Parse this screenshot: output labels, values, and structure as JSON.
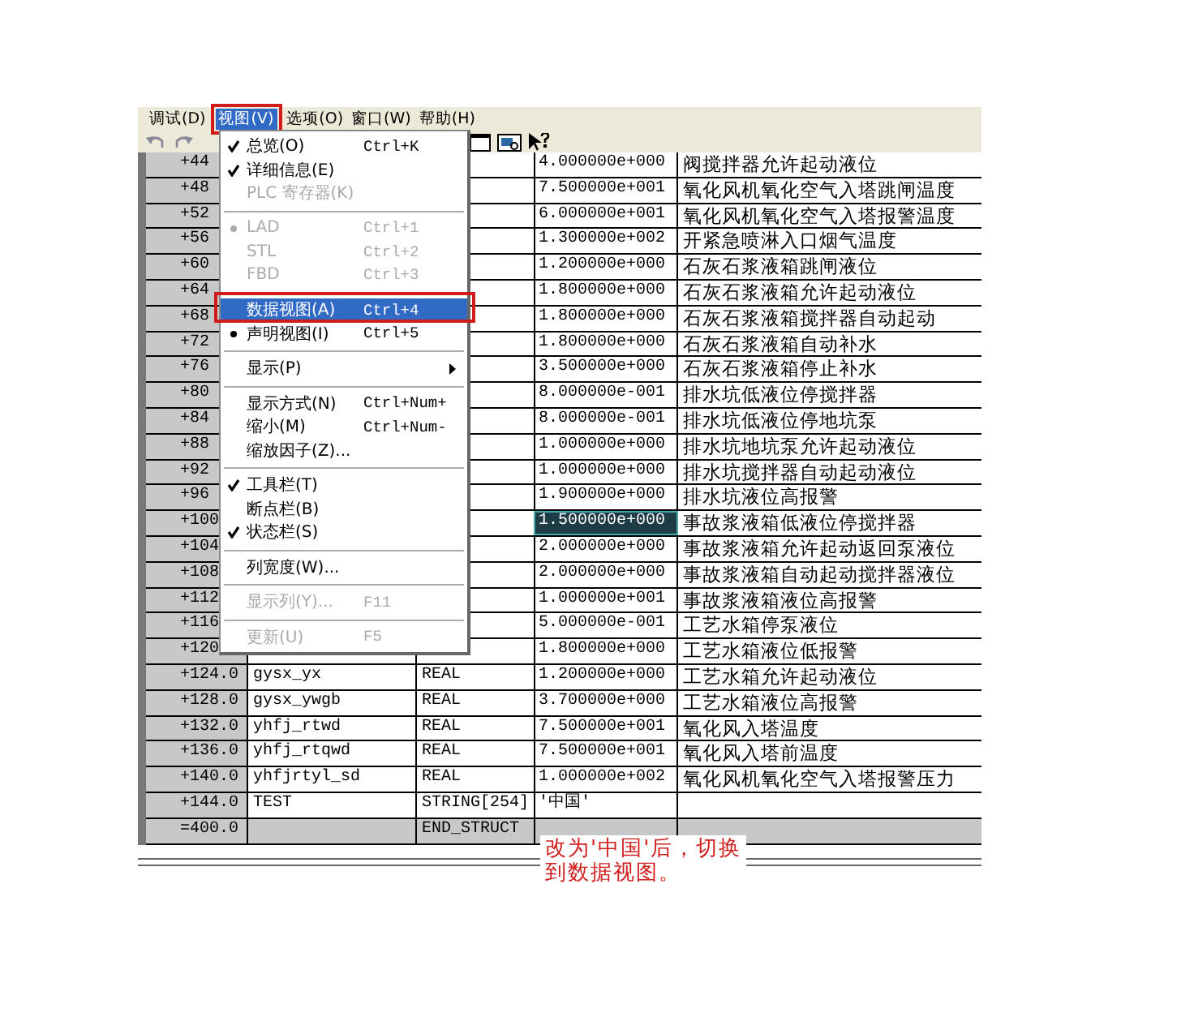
{
  "menubar": [
    {
      "label": "调试(D)",
      "selected": false
    },
    {
      "label": "视图(V)",
      "selected": true
    },
    {
      "label": "选项(O)",
      "selected": false
    },
    {
      "label": "窗口(W)",
      "selected": false
    },
    {
      "label": "帮助(H)",
      "selected": false
    }
  ],
  "view_menu": [
    {
      "kind": "item",
      "label": "总览(O)",
      "shortcut": "Ctrl+K",
      "checked": true,
      "disabled": false,
      "selected": false
    },
    {
      "kind": "item",
      "label": "详细信息(E)",
      "checked": true,
      "disabled": false,
      "selected": false
    },
    {
      "kind": "item",
      "label": "PLC 寄存器(K)",
      "checked": false,
      "disabled": true,
      "selected": false
    },
    {
      "kind": "separator"
    },
    {
      "kind": "radio",
      "label": "LAD",
      "shortcut": "Ctrl+1",
      "checked": true,
      "disabled": true,
      "selected": false
    },
    {
      "kind": "radio",
      "label": "STL",
      "shortcut": "Ctrl+2",
      "checked": false,
      "disabled": true,
      "selected": false
    },
    {
      "kind": "radio",
      "label": "FBD",
      "shortcut": "Ctrl+3",
      "checked": false,
      "disabled": true,
      "selected": false
    },
    {
      "kind": "separator"
    },
    {
      "kind": "radio",
      "label": "数据视图(A)",
      "shortcut": "Ctrl+4",
      "checked": false,
      "disabled": false,
      "selected": true
    },
    {
      "kind": "radio",
      "label": "声明视图(I)",
      "shortcut": "Ctrl+5",
      "checked": true,
      "disabled": false,
      "selected": false
    },
    {
      "kind": "separator"
    },
    {
      "kind": "submenu",
      "label": "显示(P)",
      "checked": false,
      "disabled": false,
      "selected": false
    },
    {
      "kind": "separator"
    },
    {
      "kind": "item",
      "label": "显示方式(N)",
      "shortcut": "Ctrl+Num+",
      "checked": false,
      "disabled": false,
      "selected": false
    },
    {
      "kind": "item",
      "label": "缩小(M)",
      "shortcut": "Ctrl+Num-",
      "checked": false,
      "disabled": false,
      "selected": false
    },
    {
      "kind": "item",
      "label": "缩放因子(Z)...",
      "checked": false,
      "disabled": false,
      "selected": false
    },
    {
      "kind": "separator"
    },
    {
      "kind": "item",
      "label": "工具栏(T)",
      "checked": true,
      "disabled": false,
      "selected": false
    },
    {
      "kind": "item",
      "label": "断点栏(B)",
      "checked": false,
      "disabled": false,
      "selected": false
    },
    {
      "kind": "item",
      "label": "状态栏(S)",
      "checked": true,
      "disabled": false,
      "selected": false
    },
    {
      "kind": "separator"
    },
    {
      "kind": "item",
      "label": "列宽度(W)...",
      "checked": false,
      "disabled": false,
      "selected": false
    },
    {
      "kind": "separator"
    },
    {
      "kind": "item",
      "label": "显示列(Y)...",
      "shortcut": "F11",
      "checked": false,
      "disabled": true,
      "selected": false
    },
    {
      "kind": "separator"
    },
    {
      "kind": "item",
      "label": "更新(U)",
      "shortcut": "F5",
      "checked": false,
      "disabled": true,
      "selected": false
    }
  ],
  "table": {
    "rows": [
      {
        "address": "+44",
        "value": "4.000000e+000",
        "comment": "阀搅拌器允许起动液位",
        "selected": false
      },
      {
        "address": "+48",
        "value": "7.500000e+001",
        "comment": "氧化风机氧化空气入塔跳闸温度",
        "selected": false
      },
      {
        "address": "+52",
        "value": "6.000000e+001",
        "comment": "氧化风机氧化空气入塔报警温度",
        "selected": false
      },
      {
        "address": "+56",
        "value": "1.300000e+002",
        "comment": "开紧急喷淋入口烟气温度",
        "selected": false
      },
      {
        "address": "+60",
        "value": "1.200000e+000",
        "comment": "石灰石浆液箱跳闸液位",
        "selected": false
      },
      {
        "address": "+64",
        "value": "1.800000e+000",
        "comment": "石灰石浆液箱允许起动液位",
        "selected": false
      },
      {
        "address": "+68",
        "value": "1.800000e+000",
        "comment": "石灰石浆液箱搅拌器自动起动",
        "selected": false
      },
      {
        "address": "+72",
        "value": "1.800000e+000",
        "comment": "石灰石浆液箱自动补水",
        "selected": false
      },
      {
        "address": "+76",
        "value": "3.500000e+000",
        "comment": "石灰石浆液箱停止补水",
        "selected": false
      },
      {
        "address": "+80",
        "value": "8.000000e-001",
        "comment": "排水坑低液位停搅拌器",
        "selected": false
      },
      {
        "address": "+84",
        "value": "8.000000e-001",
        "comment": "排水坑低液位停地坑泵",
        "selected": false
      },
      {
        "address": "+88",
        "value": "1.000000e+000",
        "comment": "排水坑地坑泵允许起动液位",
        "selected": false
      },
      {
        "address": "+92",
        "value": "1.000000e+000",
        "comment": "排水坑搅拌器自动起动液位",
        "selected": false
      },
      {
        "address": "+96",
        "value": "1.900000e+000",
        "comment": "排水坑液位高报警",
        "selected": false
      },
      {
        "address": "+100",
        "value": "1.500000e+000",
        "comment": "事故浆液箱低液位停搅拌器",
        "selected": true
      },
      {
        "address": "+104",
        "value": "2.000000e+000",
        "comment": "事故浆液箱允许起动返回泵液位",
        "selected": false
      },
      {
        "address": "+108",
        "value": "2.000000e+000",
        "comment": "事故浆液箱自动起动搅拌器液位",
        "selected": false
      },
      {
        "address": "+112",
        "value": "1.000000e+001",
        "comment": "事故浆液箱液位高报警",
        "selected": false
      },
      {
        "address": "+116",
        "value": "5.000000e-001",
        "comment": "工艺水箱停泵液位",
        "selected": false
      },
      {
        "address": "+120",
        "value": "1.800000e+000",
        "comment": "工艺水箱液位低报警",
        "selected": false
      },
      {
        "address": "+124.0",
        "name": "gysx_yx",
        "type": "REAL",
        "value": "1.200000e+000",
        "comment": "工艺水箱允许起动液位",
        "selected": false
      },
      {
        "address": "+128.0",
        "name": "gysx_ywgb",
        "type": "REAL",
        "value": "3.700000e+000",
        "comment": "工艺水箱液位高报警",
        "selected": false
      },
      {
        "address": "+132.0",
        "name": "yhfj_rtwd",
        "type": "REAL",
        "value": "7.500000e+001",
        "comment": "氧化风入塔温度",
        "selected": false
      },
      {
        "address": "+136.0",
        "name": "yhfj_rtqwd",
        "type": "REAL",
        "value": "7.500000e+001",
        "comment": "氧化风入塔前温度",
        "selected": false
      },
      {
        "address": "+140.0",
        "name": "yhfjrtyl_sd",
        "type": "REAL",
        "value": "1.000000e+002",
        "comment": "氧化风机氧化空气入塔报警压力",
        "selected": false
      },
      {
        "address": "+144.0",
        "name": "TEST",
        "type": "STRING[254]",
        "value": "'中国'",
        "selected": false
      },
      {
        "address": "=400.0",
        "type": "END_STRUCT",
        "kind": "end",
        "selected": false
      }
    ]
  },
  "note": [
    "改为'中国'后，切换",
    "到数据视图。"
  ]
}
